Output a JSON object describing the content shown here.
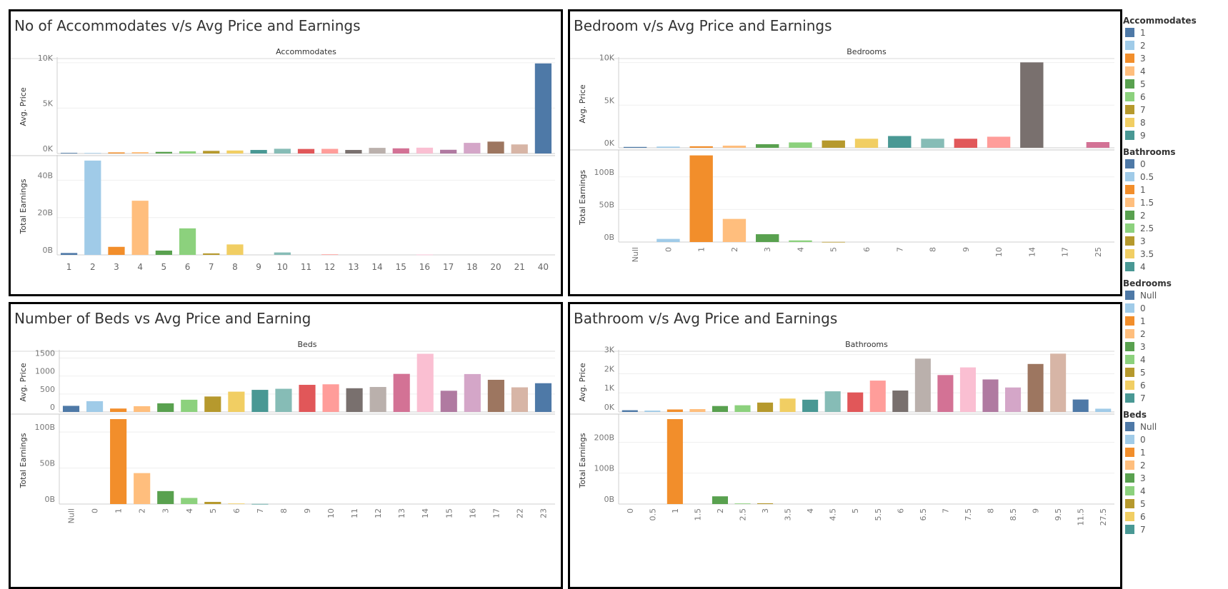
{
  "colors": [
    "#4e79a7",
    "#a0cbe8",
    "#f28e2b",
    "#ffbe7d",
    "#59a14f",
    "#8cd17d",
    "#b6992d",
    "#f1ce63",
    "#499894",
    "#86bcb6",
    "#e15759",
    "#ff9d9a",
    "#79706e",
    "#bab0ac",
    "#d37295",
    "#fabfd2",
    "#b07aa1",
    "#d4a6c8",
    "#9d7660",
    "#d7b5a6"
  ],
  "chart_data": [
    {
      "type": "bar",
      "title": "No of Accommodates v/s Avg Price and Earnings",
      "dimension": "Accommodates",
      "categories": [
        "1",
        "2",
        "3",
        "4",
        "5",
        "6",
        "7",
        "8",
        "9",
        "10",
        "11",
        "12",
        "13",
        "14",
        "15",
        "16",
        "17",
        "18",
        "20",
        "21",
        "40"
      ],
      "x_label_rotated": false,
      "series": [
        {
          "name": "Avg. Price",
          "values": [
            70,
            60,
            120,
            150,
            180,
            240,
            290,
            330,
            390,
            520,
            500,
            510,
            390,
            620,
            570,
            640,
            410,
            1170,
            1310,
            1000,
            9920
          ],
          "ticks": [
            0,
            5000,
            10000
          ],
          "tick_labels": [
            "0K",
            "5K",
            "10K"
          ],
          "ylim": [
            0,
            10300
          ]
        },
        {
          "name": "Total Earnings",
          "values": [
            1.0,
            50.5,
            4.3,
            29.0,
            2.3,
            14.2,
            0.8,
            5.6,
            0,
            1.3,
            0,
            0.3,
            0,
            0,
            0,
            0.2,
            0,
            0,
            0,
            0,
            0
          ],
          "ticks": [
            0,
            20,
            40
          ],
          "tick_labels": [
            "0B",
            "20B",
            "40B"
          ],
          "ylim": [
            0,
            52
          ]
        }
      ]
    },
    {
      "type": "bar",
      "title": "Bedroom v/s Avg Price and Earnings",
      "dimension": "Bedrooms",
      "categories": [
        "Null",
        "0",
        "1",
        "2",
        "3",
        "4",
        "5",
        "6",
        "7",
        "8",
        "9",
        "10",
        "14",
        "17",
        "25"
      ],
      "x_label_rotated": true,
      "series": [
        {
          "name": "Avg. Price",
          "values": [
            100,
            140,
            180,
            250,
            420,
            630,
            860,
            1060,
            1380,
            1060,
            1060,
            1300,
            10020,
            0,
            670
          ],
          "ticks": [
            0,
            5000,
            10000
          ],
          "tick_labels": [
            "0K",
            "5K",
            "10K"
          ],
          "ylim": [
            0,
            10300
          ]
        },
        {
          "name": "Total Earnings",
          "values": [
            0,
            4.8,
            133,
            35.5,
            12,
            2.5,
            0.2,
            0,
            0,
            0,
            0,
            0,
            0,
            0,
            0
          ],
          "ticks": [
            0,
            50,
            100
          ],
          "tick_labels": [
            "0B",
            "50B",
            "100B"
          ],
          "ylim": [
            0,
            137
          ]
        }
      ]
    },
    {
      "type": "bar",
      "title": "Number of Beds vs Avg Price and Earning",
      "dimension": "Beds",
      "categories": [
        "Null",
        "0",
        "1",
        "2",
        "3",
        "4",
        "5",
        "6",
        "7",
        "8",
        "9",
        "10",
        "11",
        "12",
        "13",
        "14",
        "15",
        "16",
        "17",
        "22",
        "23"
      ],
      "x_label_rotated": true,
      "series": [
        {
          "name": "Avg. Price",
          "values": [
            170,
            300,
            95,
            160,
            240,
            340,
            430,
            565,
            615,
            645,
            755,
            770,
            660,
            695,
            1060,
            1620,
            590,
            1055,
            895,
            685,
            800
          ],
          "ticks": [
            0,
            500,
            1000,
            1500
          ],
          "tick_labels": [
            "0",
            "500",
            "1000",
            "1500"
          ],
          "ylim": [
            0,
            1650
          ]
        },
        {
          "name": "Total Earnings",
          "values": [
            0,
            0,
            118,
            43,
            18,
            8.5,
            3,
            0.8,
            0.2,
            0,
            0,
            0,
            0,
            0,
            0,
            0,
            0,
            0,
            0,
            0,
            0
          ],
          "ticks": [
            0,
            50,
            100
          ],
          "tick_labels": [
            "0B",
            "50B",
            "100B"
          ],
          "ylim": [
            0,
            121
          ]
        }
      ]
    },
    {
      "type": "bar",
      "title": "Bathroom v/s Avg Price and Earnings",
      "dimension": "Bathrooms",
      "categories": [
        "0",
        "0.5",
        "1",
        "1.5",
        "2",
        "2.5",
        "3",
        "3.5",
        "4",
        "4.5",
        "5",
        "5.5",
        "6",
        "6.5",
        "7",
        "7.5",
        "8",
        "8.5",
        "9",
        "9.5",
        "11.5",
        "27.5"
      ],
      "x_label_rotated": true,
      "series": [
        {
          "name": "Avg. Price",
          "values": [
            90,
            70,
            130,
            150,
            310,
            350,
            490,
            700,
            640,
            1080,
            1020,
            1640,
            1120,
            2790,
            1930,
            2330,
            1700,
            1280,
            2510,
            3050,
            650,
            170
          ],
          "ticks": [
            0,
            1000,
            2000,
            3000
          ],
          "tick_labels": [
            "0K",
            "1K",
            "2K",
            "3K"
          ],
          "ylim": [
            0,
            3100
          ]
        },
        {
          "name": "Total Earnings",
          "values": [
            0,
            0,
            275,
            0,
            25,
            2,
            2.5,
            0,
            0,
            0,
            0,
            0,
            0,
            0,
            0,
            0,
            0,
            0,
            0,
            0,
            0,
            0
          ],
          "ticks": [
            0,
            100,
            200
          ],
          "tick_labels": [
            "0B",
            "100B",
            "200B"
          ],
          "ylim": [
            0,
            282
          ]
        }
      ]
    }
  ],
  "legends": [
    {
      "title": "Accommodates",
      "items": [
        {
          "label": "1",
          "color": "#4e79a7"
        },
        {
          "label": "2",
          "color": "#a0cbe8"
        },
        {
          "label": "3",
          "color": "#f28e2b"
        },
        {
          "label": "4",
          "color": "#ffbe7d"
        },
        {
          "label": "5",
          "color": "#59a14f"
        },
        {
          "label": "6",
          "color": "#8cd17d"
        },
        {
          "label": "7",
          "color": "#b6992d"
        },
        {
          "label": "8",
          "color": "#f1ce63"
        },
        {
          "label": "9",
          "color": "#499894"
        }
      ]
    },
    {
      "title": "Bathrooms",
      "items": [
        {
          "label": "0",
          "color": "#4e79a7"
        },
        {
          "label": "0.5",
          "color": "#a0cbe8"
        },
        {
          "label": "1",
          "color": "#f28e2b"
        },
        {
          "label": "1.5",
          "color": "#ffbe7d"
        },
        {
          "label": "2",
          "color": "#59a14f"
        },
        {
          "label": "2.5",
          "color": "#8cd17d"
        },
        {
          "label": "3",
          "color": "#b6992d"
        },
        {
          "label": "3.5",
          "color": "#f1ce63"
        },
        {
          "label": "4",
          "color": "#499894"
        }
      ]
    },
    {
      "title": "Bedrooms",
      "items": [
        {
          "label": "Null",
          "color": "#4e79a7"
        },
        {
          "label": "0",
          "color": "#a0cbe8"
        },
        {
          "label": "1",
          "color": "#f28e2b"
        },
        {
          "label": "2",
          "color": "#ffbe7d"
        },
        {
          "label": "3",
          "color": "#59a14f"
        },
        {
          "label": "4",
          "color": "#8cd17d"
        },
        {
          "label": "5",
          "color": "#b6992d"
        },
        {
          "label": "6",
          "color": "#f1ce63"
        },
        {
          "label": "7",
          "color": "#499894"
        }
      ]
    },
    {
      "title": "Beds",
      "items": [
        {
          "label": "Null",
          "color": "#4e79a7"
        },
        {
          "label": "0",
          "color": "#a0cbe8"
        },
        {
          "label": "1",
          "color": "#f28e2b"
        },
        {
          "label": "2",
          "color": "#ffbe7d"
        },
        {
          "label": "3",
          "color": "#59a14f"
        },
        {
          "label": "4",
          "color": "#8cd17d"
        },
        {
          "label": "5",
          "color": "#b6992d"
        },
        {
          "label": "6",
          "color": "#f1ce63"
        },
        {
          "label": "7",
          "color": "#499894"
        }
      ]
    }
  ]
}
